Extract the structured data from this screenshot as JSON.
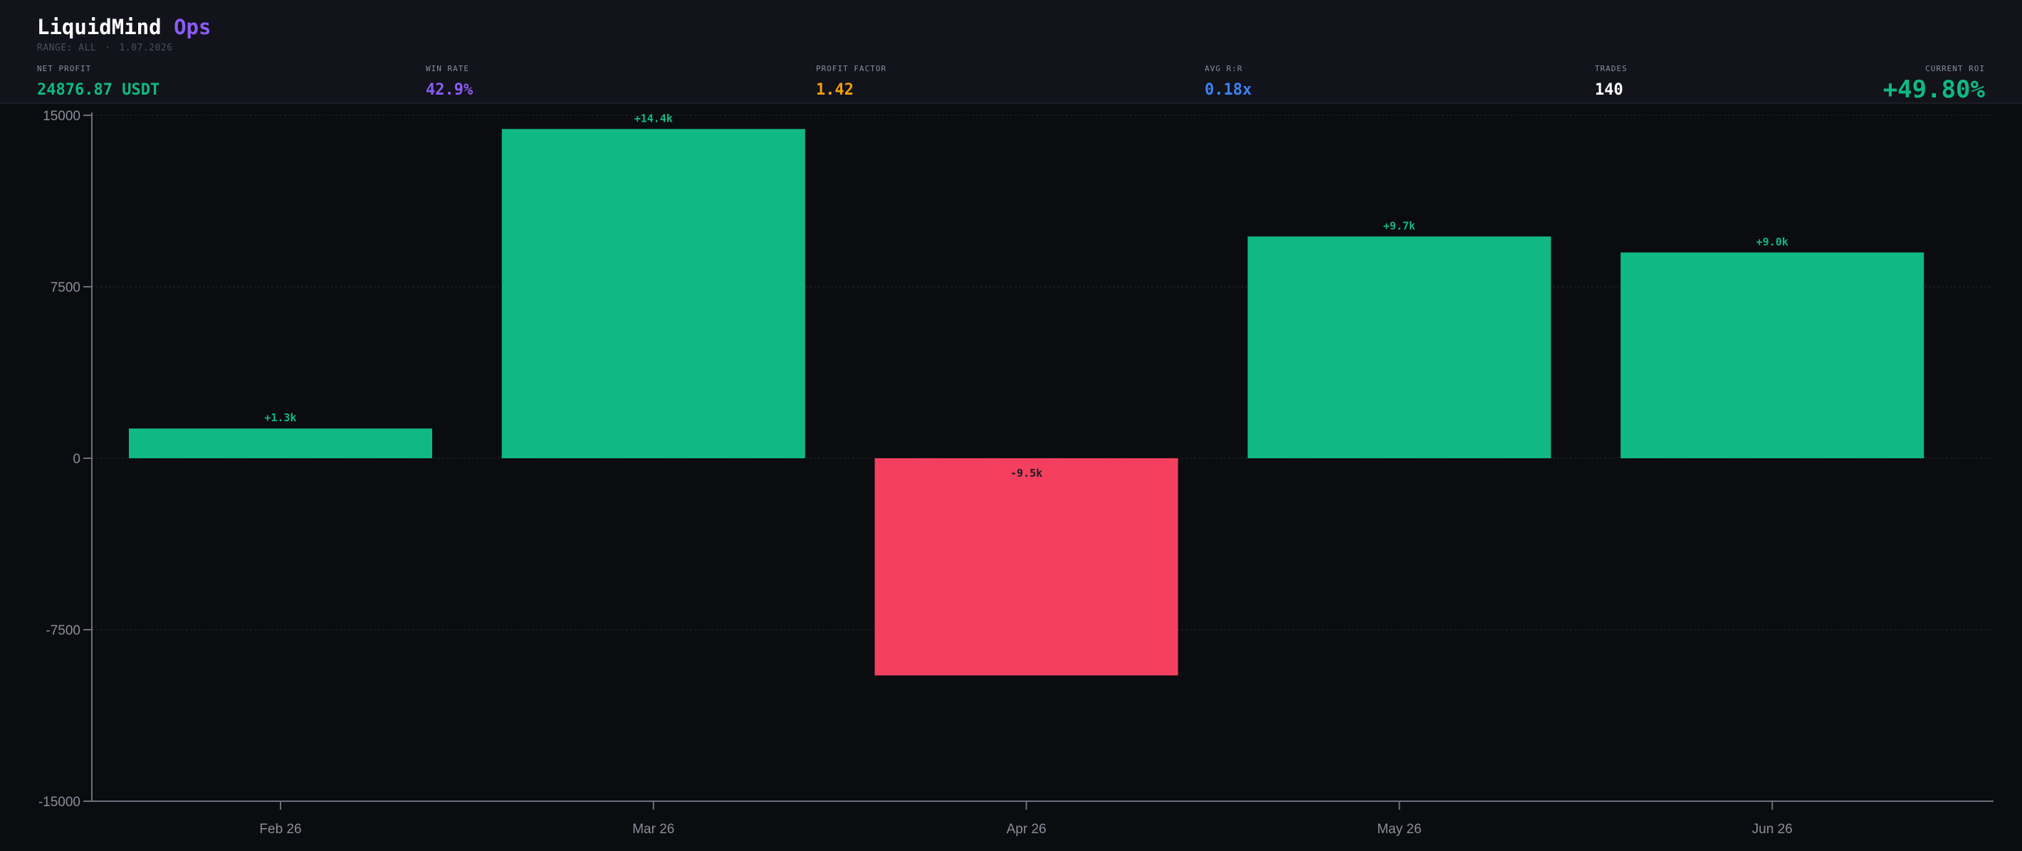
{
  "app": {
    "brand_main": "LiquidMind",
    "brand_accent": "Ops",
    "range_text": "RANGE: ALL",
    "separator": "·",
    "date_text": "1.07.2026"
  },
  "stats": [
    {
      "label": "NET PROFIT",
      "value": "24876.87 USDT",
      "color": "#10b981"
    },
    {
      "label": "WIN RATE",
      "value": "42.9%",
      "color": "#8b5cf6"
    },
    {
      "label": "PROFIT FACTOR",
      "value": "1.42",
      "color": "#f59e0b"
    },
    {
      "label": "AVG R:R",
      "value": "0.18x",
      "color": "#3b82f6"
    },
    {
      "label": "TRADES",
      "value": "140",
      "color": "#ffffff"
    },
    {
      "label": "CURRENT ROI",
      "value": "+49.80%",
      "color": "#10b981"
    }
  ],
  "colors": {
    "positive": "#10b981",
    "negative": "#f43f5e",
    "axis": "#6b6f7b",
    "grid": "#1c1e27",
    "background": "#0b0c10"
  },
  "chart_data": {
    "type": "bar",
    "categories": [
      "Feb 26",
      "Mar 26",
      "Apr 26",
      "May 26",
      "Jun 26"
    ],
    "values": [
      1300,
      14400,
      -9500,
      9700,
      9000
    ],
    "data_labels": [
      "+1.3k",
      "+14.4k",
      "-9.5k",
      "+9.7k",
      "+9.0k"
    ],
    "y_ticks": [
      15000,
      7500,
      0,
      -7500,
      -15000
    ],
    "ylim": [
      -15000,
      15000
    ],
    "grid": true,
    "legend": "none"
  }
}
